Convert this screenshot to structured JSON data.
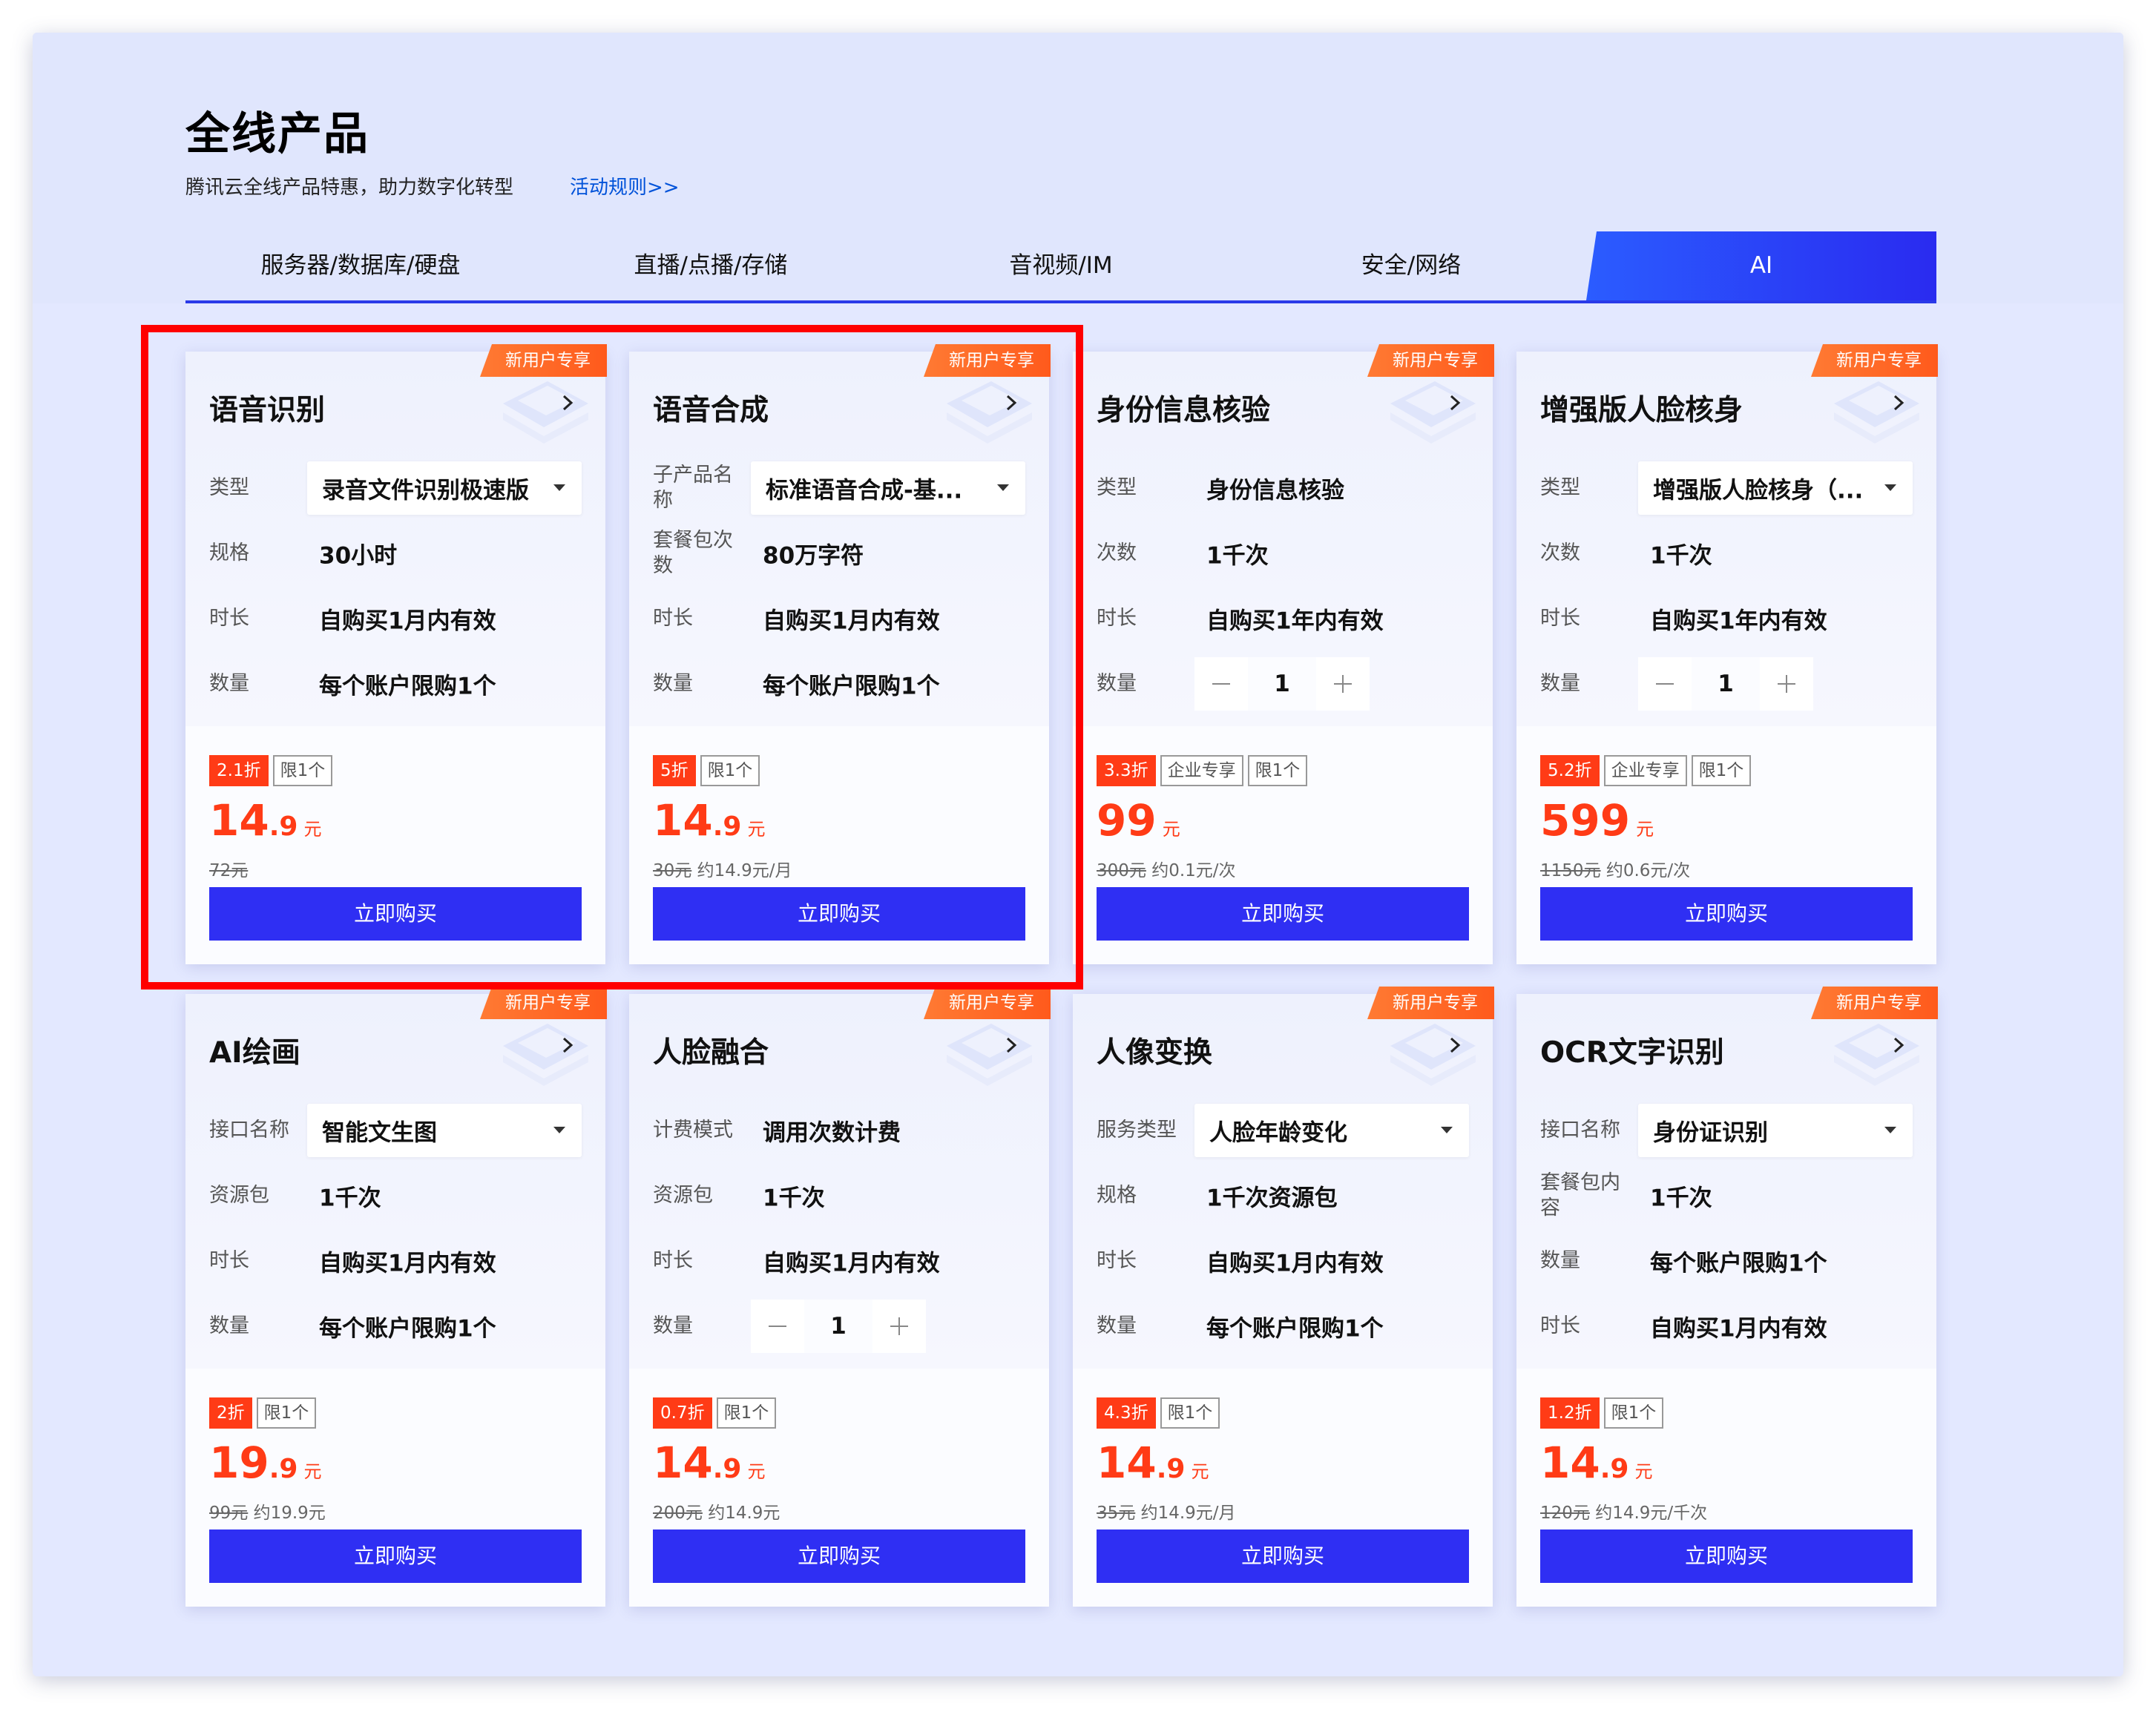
{
  "page": {
    "title": "全线产品",
    "subtitle": "腾讯云全线产品特惠，助力数字化转型",
    "rules_link": "活动规则>>"
  },
  "tabs": [
    {
      "label": "服务器/数据库/硬盘",
      "active": false
    },
    {
      "label": "直播/点播/存储",
      "active": false
    },
    {
      "label": "音视频/IM",
      "active": false
    },
    {
      "label": "安全/网络",
      "active": false
    },
    {
      "label": "AI",
      "active": true
    }
  ],
  "colors": {
    "accent": "#2f2ff3",
    "badge": "#ff5a1c",
    "price": "#ff3b16",
    "highlight": "#ff0000",
    "background": "#e3e8ff"
  },
  "cards": [
    {
      "badge": "新用户专享",
      "title": "语音识别",
      "rows": [
        {
          "label": "类型",
          "value": "录音文件识别极速版",
          "kind": "select"
        },
        {
          "label": "规格",
          "value": "30小时",
          "kind": "text"
        },
        {
          "label": "时长",
          "value": "自购买1月内有效",
          "kind": "text"
        },
        {
          "label": "数量",
          "value": "每个账户限购1个",
          "kind": "text"
        }
      ],
      "tags": {
        "discount": "2.1折",
        "t1": "限1个",
        "t2": ""
      },
      "price": {
        "int": "14",
        "dec": ".9",
        "unit": "元"
      },
      "orig": {
        "strike": "72元",
        "note": ""
      },
      "buy": "立即购买"
    },
    {
      "badge": "新用户专享",
      "title": "语音合成",
      "rows": [
        {
          "label": "子产品名称",
          "value": "标准语音合成-基...",
          "kind": "select"
        },
        {
          "label": "套餐包次数",
          "value": "80万字符",
          "kind": "text"
        },
        {
          "label": "时长",
          "value": "自购买1月内有效",
          "kind": "text"
        },
        {
          "label": "数量",
          "value": "每个账户限购1个",
          "kind": "text"
        }
      ],
      "tags": {
        "discount": "5折",
        "t1": "限1个",
        "t2": ""
      },
      "price": {
        "int": "14",
        "dec": ".9",
        "unit": "元"
      },
      "orig": {
        "strike": "30元",
        "note": "约14.9元/月"
      },
      "buy": "立即购买"
    },
    {
      "badge": "新用户专享",
      "title": "身份信息核验",
      "rows": [
        {
          "label": "类型",
          "value": "身份信息核验",
          "kind": "text"
        },
        {
          "label": "次数",
          "value": "1千次",
          "kind": "text"
        },
        {
          "label": "时长",
          "value": "自购买1年内有效",
          "kind": "text"
        },
        {
          "label": "数量",
          "value": "1",
          "kind": "stepper"
        }
      ],
      "tags": {
        "discount": "3.3折",
        "t1": "企业专享",
        "t2": "限1个"
      },
      "price": {
        "int": "99",
        "dec": "",
        "unit": "元"
      },
      "orig": {
        "strike": "300元",
        "note": "约0.1元/次"
      },
      "buy": "立即购买"
    },
    {
      "badge": "新用户专享",
      "title": "增强版人脸核身",
      "rows": [
        {
          "label": "类型",
          "value": "增强版人脸核身（...",
          "kind": "select"
        },
        {
          "label": "次数",
          "value": "1千次",
          "kind": "text"
        },
        {
          "label": "时长",
          "value": "自购买1年内有效",
          "kind": "text"
        },
        {
          "label": "数量",
          "value": "1",
          "kind": "stepper"
        }
      ],
      "tags": {
        "discount": "5.2折",
        "t1": "企业专享",
        "t2": "限1个"
      },
      "price": {
        "int": "599",
        "dec": "",
        "unit": "元"
      },
      "orig": {
        "strike": "1150元",
        "note": "约0.6元/次"
      },
      "buy": "立即购买"
    },
    {
      "badge": "新用户专享",
      "title": "AI绘画",
      "rows": [
        {
          "label": "接口名称",
          "value": "智能文生图",
          "kind": "select"
        },
        {
          "label": "资源包",
          "value": "1千次",
          "kind": "text"
        },
        {
          "label": "时长",
          "value": "自购买1月内有效",
          "kind": "text"
        },
        {
          "label": "数量",
          "value": "每个账户限购1个",
          "kind": "text"
        }
      ],
      "tags": {
        "discount": "2折",
        "t1": "限1个",
        "t2": ""
      },
      "price": {
        "int": "19",
        "dec": ".9",
        "unit": "元"
      },
      "orig": {
        "strike": "99元",
        "note": "约19.9元"
      },
      "buy": "立即购买"
    },
    {
      "badge": "新用户专享",
      "title": "人脸融合",
      "rows": [
        {
          "label": "计费模式",
          "value": "调用次数计费",
          "kind": "text"
        },
        {
          "label": "资源包",
          "value": "1千次",
          "kind": "text"
        },
        {
          "label": "时长",
          "value": "自购买1月内有效",
          "kind": "text"
        },
        {
          "label": "数量",
          "value": "1",
          "kind": "stepper"
        }
      ],
      "tags": {
        "discount": "0.7折",
        "t1": "限1个",
        "t2": ""
      },
      "price": {
        "int": "14",
        "dec": ".9",
        "unit": "元"
      },
      "orig": {
        "strike": "200元",
        "note": "约14.9元"
      },
      "buy": "立即购买"
    },
    {
      "badge": "新用户专享",
      "title": "人像变换",
      "rows": [
        {
          "label": "服务类型",
          "value": "人脸年龄变化",
          "kind": "select"
        },
        {
          "label": "规格",
          "value": "1千次资源包",
          "kind": "text"
        },
        {
          "label": "时长",
          "value": "自购买1月内有效",
          "kind": "text"
        },
        {
          "label": "数量",
          "value": "每个账户限购1个",
          "kind": "text"
        }
      ],
      "tags": {
        "discount": "4.3折",
        "t1": "限1个",
        "t2": ""
      },
      "price": {
        "int": "14",
        "dec": ".9",
        "unit": "元"
      },
      "orig": {
        "strike": "35元",
        "note": "约14.9元/月"
      },
      "buy": "立即购买"
    },
    {
      "badge": "新用户专享",
      "title": "OCR文字识别",
      "rows": [
        {
          "label": "接口名称",
          "value": "身份证识别",
          "kind": "select"
        },
        {
          "label": "套餐包内容",
          "value": "1千次",
          "kind": "text"
        },
        {
          "label": "数量",
          "value": "每个账户限购1个",
          "kind": "text"
        },
        {
          "label": "时长",
          "value": "自购买1月内有效",
          "kind": "text"
        }
      ],
      "tags": {
        "discount": "1.2折",
        "t1": "限1个",
        "t2": ""
      },
      "price": {
        "int": "14",
        "dec": ".9",
        "unit": "元"
      },
      "orig": {
        "strike": "120元",
        "note": "约14.9元/千次"
      },
      "buy": "立即购买"
    }
  ]
}
